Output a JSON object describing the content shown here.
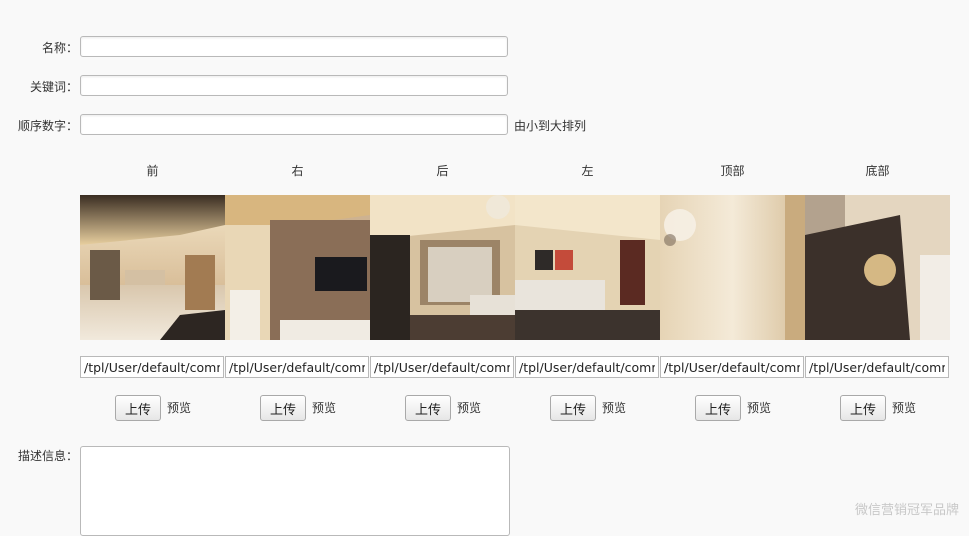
{
  "form": {
    "name_label": "名称：",
    "name_value": "",
    "keyword_label": "关键词：",
    "keyword_value": "",
    "order_label": "顺序数字：",
    "order_value": "",
    "order_hint": "由小到大排列",
    "description_label": "描述信息："
  },
  "faces": [
    {
      "label": "前",
      "path": "/tpl/User/default/common/",
      "upload": "上传",
      "preview": "预览"
    },
    {
      "label": "右",
      "path": "/tpl/User/default/common/",
      "upload": "上传",
      "preview": "预览"
    },
    {
      "label": "后",
      "path": "/tpl/User/default/common/",
      "upload": "上传",
      "preview": "预览"
    },
    {
      "label": "左",
      "path": "/tpl/User/default/common/",
      "upload": "上传",
      "preview": "预览"
    },
    {
      "label": "顶部",
      "path": "/tpl/User/default/common/",
      "upload": "上传",
      "preview": "预览"
    },
    {
      "label": "底部",
      "path": "/tpl/User/default/common/",
      "upload": "上传",
      "preview": "预览"
    }
  ],
  "watermark": "微信营销冠军品牌"
}
